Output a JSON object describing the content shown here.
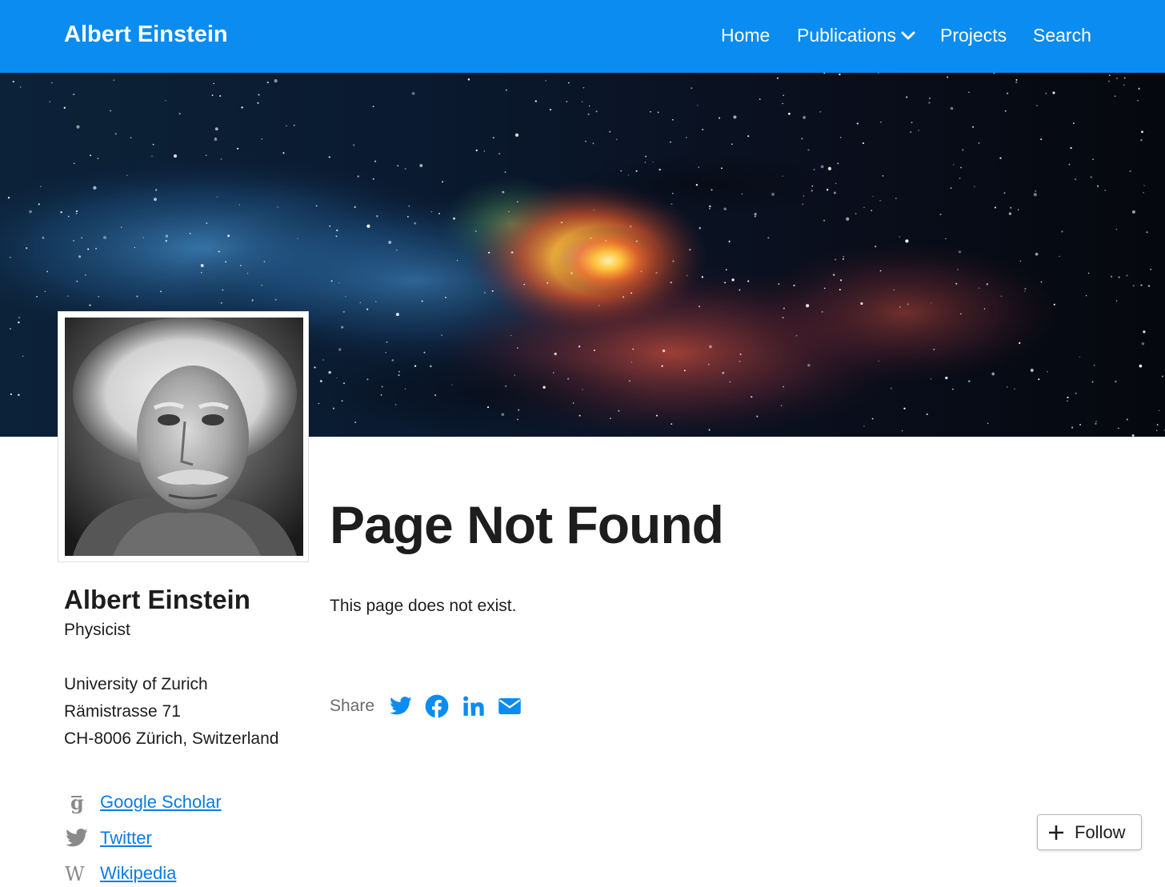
{
  "navbar": {
    "brand": "Albert Einstein",
    "items": [
      {
        "label": "Home"
      },
      {
        "label": "Publications",
        "has_dropdown": true
      },
      {
        "label": "Projects"
      },
      {
        "label": "Search"
      }
    ],
    "background_color": "#0a8cf0"
  },
  "profile": {
    "name": "Albert Einstein",
    "role": "Physicist",
    "address": [
      "University of Zurich",
      "Rämistrasse 71",
      "CH-8006 Zürich, Switzerland"
    ],
    "links": [
      {
        "label": "Google Scholar",
        "icon": "google-scholar-icon"
      },
      {
        "label": "Twitter",
        "icon": "twitter-icon"
      },
      {
        "label": "Wikipedia",
        "icon": "wikipedia-icon"
      }
    ]
  },
  "main": {
    "title": "Page Not Found",
    "message": "This page does not exist.",
    "share": {
      "label": "Share",
      "icons": [
        "twitter-icon",
        "facebook-icon",
        "linkedin-icon",
        "email-icon"
      ]
    }
  },
  "follow": {
    "label": "Follow",
    "icon": "plus-icon"
  },
  "colors": {
    "accent": "#0a8cf0",
    "link": "#0a7ce8",
    "text": "#1d1d1d",
    "muted": "#6b6b6b"
  }
}
